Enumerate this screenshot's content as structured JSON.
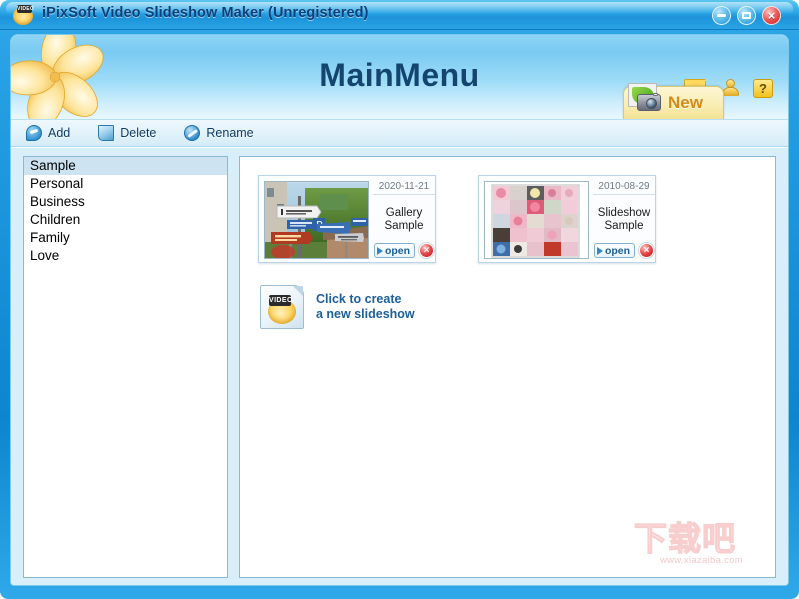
{
  "window": {
    "title": "iPixSoft Video Slideshow Maker (Unregistered)",
    "app_icon": "video-slideshow-app-icon",
    "video_tag": "VIDEO",
    "controls": {
      "minimize_label": "",
      "maximize_label": "",
      "close_label": "×"
    }
  },
  "header": {
    "page_title": "MainMenu",
    "logo": "flower-logo",
    "icons": [
      {
        "name": "mail-icon",
        "label": ""
      },
      {
        "name": "user-icon",
        "label": ""
      },
      {
        "name": "help-icon",
        "label": "?"
      }
    ],
    "new_button": {
      "label": "New",
      "icon": "photo-camera-icon"
    }
  },
  "toolbar": {
    "items": [
      {
        "name": "add",
        "label": "Add",
        "icon": "add-arrow-icon"
      },
      {
        "name": "delete",
        "label": "Delete",
        "icon": "delete-page-icon"
      },
      {
        "name": "rename",
        "label": "Rename",
        "icon": "rename-pencil-icon"
      }
    ]
  },
  "sidebar": {
    "items": [
      {
        "label": "Sample",
        "selected": true
      },
      {
        "label": "Personal",
        "selected": false
      },
      {
        "label": "Business",
        "selected": false
      },
      {
        "label": "Children",
        "selected": false
      },
      {
        "label": "Family",
        "selected": false
      },
      {
        "label": "Love",
        "selected": false
      }
    ]
  },
  "projects": {
    "cards": [
      {
        "date": "2020-11-21",
        "name_line1": "Gallery",
        "name_line2": "Sample",
        "open_label": "open",
        "delete_label": "×",
        "thumbnail": "street-direction-signs-photo"
      },
      {
        "date": "2010-08-29",
        "name_line1": "Slideshow",
        "name_line2": "Sample",
        "open_label": "open",
        "delete_label": "×",
        "thumbnail": "pink-collage-photo"
      }
    ],
    "create_new": {
      "line1": "Click to create",
      "line2": "a new slideshow",
      "icon": "new-video-document-icon",
      "video_tag": "VIDEO"
    }
  },
  "watermark": {
    "characters": "下载吧",
    "url": "www.xiazaiba.com"
  },
  "colors": {
    "window_blue": "#1d97de",
    "title_text": "#0e3f78",
    "header_title": "#13456e",
    "accent_orange": "#d58a16",
    "link_blue": "#1b5f9c",
    "close_red": "#c81818",
    "selected_row": "#cde3f2",
    "body_bg": "#d8effa"
  }
}
